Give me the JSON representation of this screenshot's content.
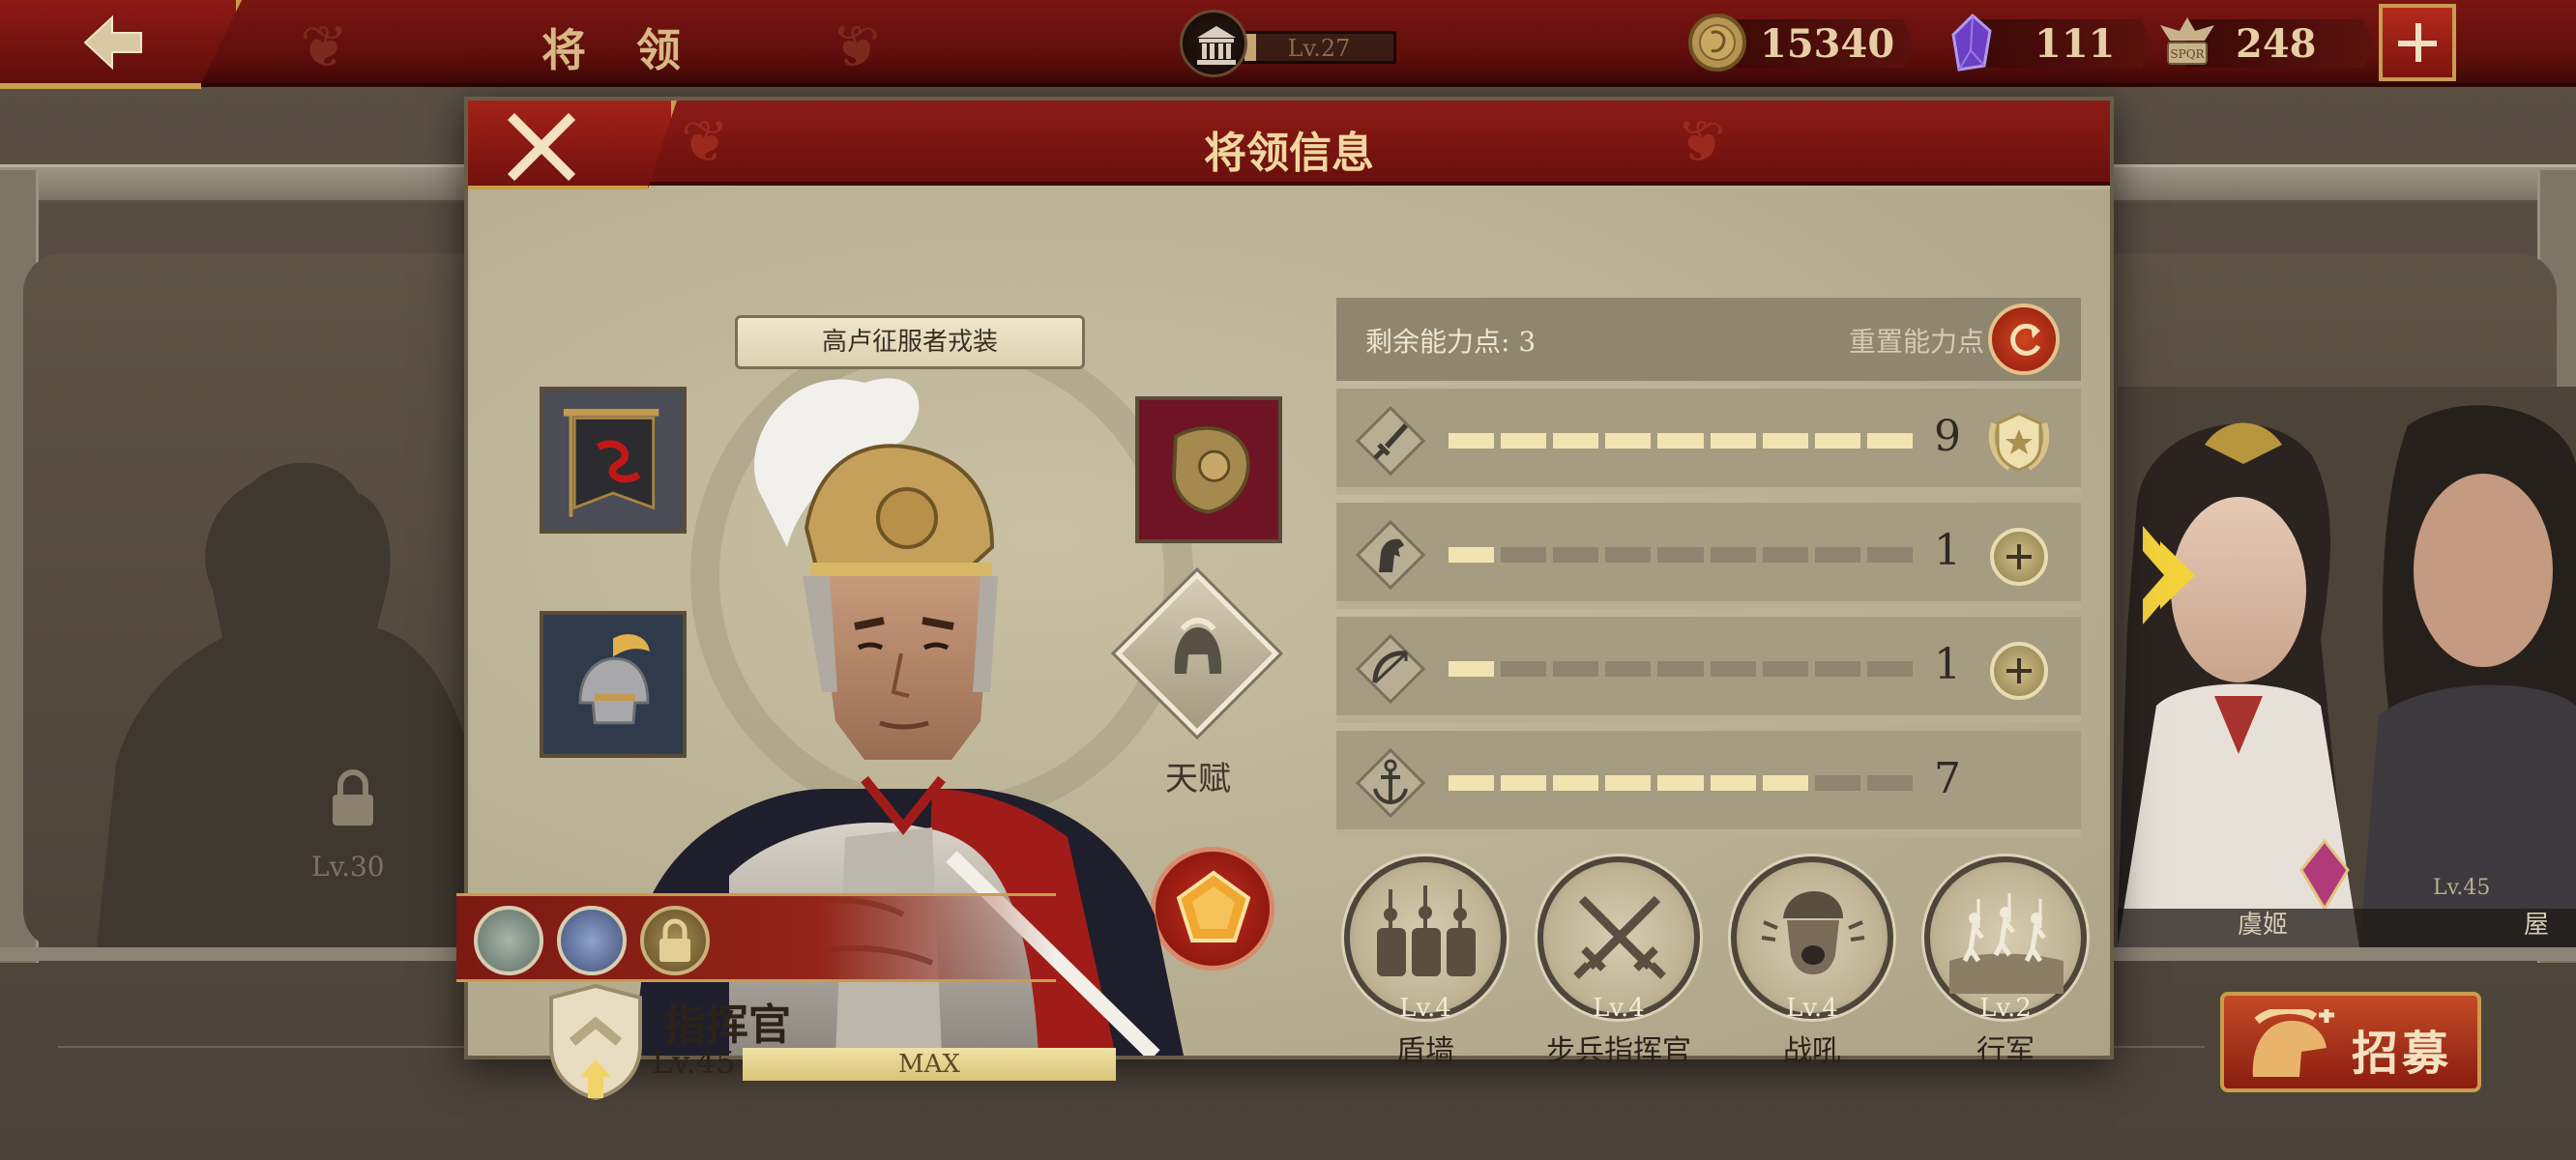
{
  "topbar": {
    "title": "将 领",
    "level": "Lv.27",
    "resources": [
      {
        "icon": "gold-coin-icon",
        "value": "15340"
      },
      {
        "icon": "purple-gem-icon",
        "value": "111"
      },
      {
        "icon": "spqr-eagle-icon",
        "value": "248"
      }
    ]
  },
  "roster": {
    "locked_level": "Lv.30",
    "right_hero_name": "虞姬",
    "right_hero_level": "Lv.45",
    "far_right_name": "屋",
    "recruit_label": "招募"
  },
  "dialog": {
    "title": "将领信息",
    "outfit": "高卢征服者戎装",
    "talent_label": "天赋",
    "rank_name": "指挥官",
    "rank_level": "Lv.45",
    "rank_bar_text": "MAX",
    "stats": {
      "remaining_points": "剩余能力点: 3",
      "reset_label": "重置能力点",
      "rows": [
        {
          "icon": "sword-icon",
          "value": "9",
          "filled": 9,
          "action": "medal"
        },
        {
          "icon": "horse-icon",
          "value": "1",
          "filled": 1,
          "action": "plus"
        },
        {
          "icon": "bow-icon",
          "value": "1",
          "filled": 1,
          "action": "plus"
        },
        {
          "icon": "anchor-icon",
          "value": "7",
          "filled": 7,
          "action": "none"
        }
      ],
      "segments": 9
    },
    "skills": [
      {
        "name": "盾墙",
        "level": "Lv.4"
      },
      {
        "name": "步兵指挥官",
        "level": "Lv.4"
      },
      {
        "name": "战吼",
        "level": "Lv.4"
      },
      {
        "name": "行军",
        "level": "Lv.2"
      }
    ]
  },
  "colors": {
    "crimson": "#7a1512",
    "gold": "#c99c4e",
    "parchment": "#b9b095"
  }
}
